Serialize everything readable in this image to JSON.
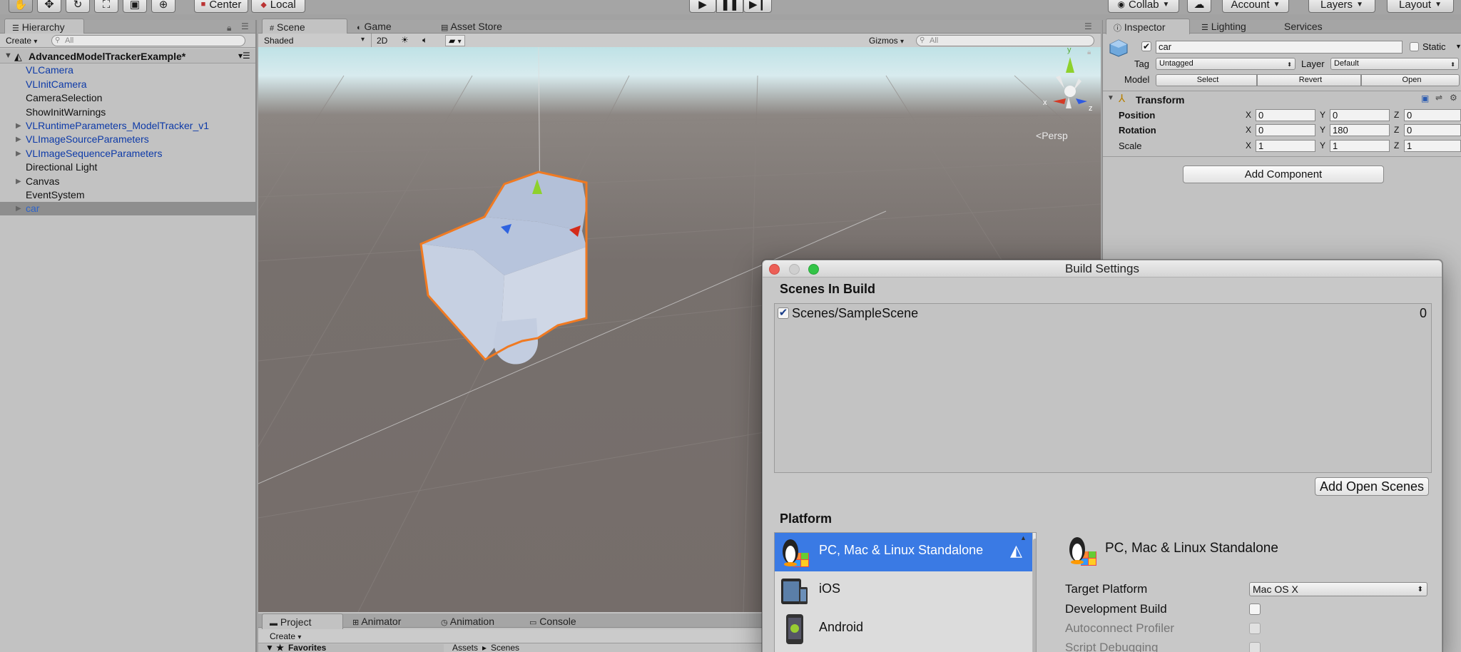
{
  "toolbar": {
    "pivot_label": "Center",
    "space_label": "Local",
    "collab_label": "Collab",
    "account_label": "Account",
    "layers_label": "Layers",
    "layout_label": "Layout"
  },
  "hierarchy": {
    "tab_label": "Hierarchy",
    "create_label": "Create",
    "search_placeholder": "All",
    "scene_name": "AdvancedModelTrackerExample*",
    "items": [
      {
        "label": "VLCamera"
      },
      {
        "label": "VLInitCamera"
      },
      {
        "label": "CameraSelection"
      },
      {
        "label": "ShowInitWarnings"
      },
      {
        "label": "VLRuntimeParameters_ModelTracker_v1"
      },
      {
        "label": "VLImageSourceParameters"
      },
      {
        "label": "VLImageSequenceParameters"
      },
      {
        "label": "Directional Light"
      },
      {
        "label": "Canvas"
      },
      {
        "label": "EventSystem"
      },
      {
        "label": "car"
      }
    ]
  },
  "scene_panel": {
    "tabs": [
      "Scene",
      "Game",
      "Asset Store"
    ],
    "shading_mode": "Shaded",
    "mode_2d": "2D",
    "gizmos_label": "Gizmos",
    "search_placeholder": "All",
    "gizmo_axes": {
      "x": "x",
      "y": "y",
      "z": "z"
    },
    "persp_label": "Persp"
  },
  "bottom_panel": {
    "tabs": [
      "Project",
      "Animator",
      "Animation",
      "Console"
    ],
    "create_label": "Create",
    "favorites_label": "Favorites",
    "breadcrumb": [
      "Assets",
      "Scenes"
    ]
  },
  "inspector": {
    "tabs": [
      "Inspector",
      "Lighting",
      "Services"
    ],
    "object_name": "car",
    "static_label": "Static",
    "tag_label": "Tag",
    "tag_value": "Untagged",
    "layer_label": "Layer",
    "layer_value": "Default",
    "model_label": "Model",
    "model_buttons": [
      "Select",
      "Revert",
      "Open"
    ],
    "transform_title": "Transform",
    "position": {
      "label": "Position",
      "x": "0",
      "y": "0",
      "z": "0"
    },
    "rotation": {
      "label": "Rotation",
      "x": "0",
      "y": "180",
      "z": "0"
    },
    "scale": {
      "label": "Scale",
      "x": "1",
      "y": "1",
      "z": "1"
    },
    "axis_labels": [
      "X",
      "Y",
      "Z"
    ],
    "add_component_label": "Add Component"
  },
  "build_settings": {
    "title": "Build Settings",
    "scenes_header": "Scenes In Build",
    "scene_entry": {
      "path": "Scenes/SampleScene",
      "index": "0",
      "checked": true
    },
    "add_open_scenes_label": "Add Open Scenes",
    "platform_header": "Platform",
    "platforms": [
      {
        "label": "PC, Mac & Linux Standalone",
        "selected": true
      },
      {
        "label": "iOS",
        "selected": false
      },
      {
        "label": "Android",
        "selected": false
      }
    ],
    "selected_platform_title": "PC, Mac & Linux Standalone",
    "target_platform_label": "Target Platform",
    "target_platform_value": "Mac OS X",
    "development_build_label": "Development Build",
    "autoconnect_profiler_label": "Autoconnect Profiler",
    "script_debugging_label": "Script Debugging"
  },
  "colors": {
    "selection_blue": "#3a7ae4",
    "hierarchy_prefab_text": "#0d3aa8",
    "selection_outline": "#f07a22"
  }
}
